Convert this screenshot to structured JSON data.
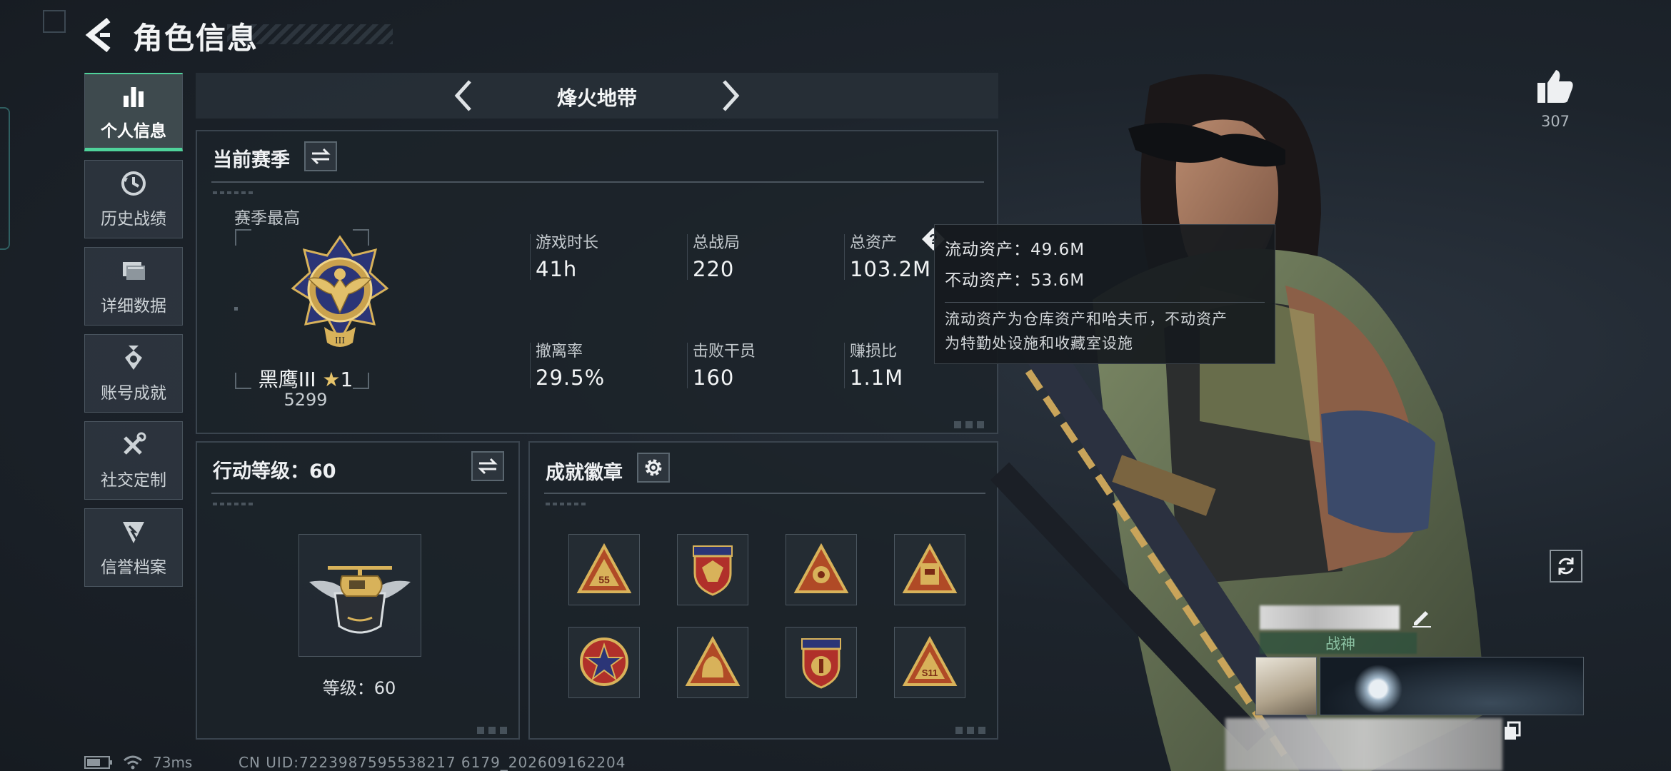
{
  "header": {
    "title": "角色信息"
  },
  "sidebar": {
    "items": [
      {
        "label": "个人信息",
        "icon": "bar-chart-icon",
        "active": true
      },
      {
        "label": "历史战绩",
        "icon": "history-clock-icon"
      },
      {
        "label": "详细数据",
        "icon": "folder-icon"
      },
      {
        "label": "账号成就",
        "icon": "achievement-medal-icon"
      },
      {
        "label": "社交定制",
        "icon": "tools-icon"
      },
      {
        "label": "信誉档案",
        "icon": "reputation-icon"
      }
    ]
  },
  "mode_selector": {
    "label": "烽火地带"
  },
  "season": {
    "title": "当前赛季",
    "best_label": "赛季最高",
    "rank_name": "黑鹰III",
    "rank_stars": "1",
    "rank_points": "5299",
    "stats": [
      {
        "label": "游戏时长",
        "value": "41h"
      },
      {
        "label": "总战局",
        "value": "220"
      },
      {
        "label": "总资产",
        "value": "103.2M"
      },
      {
        "label": "撤离率",
        "value": "29.5%"
      },
      {
        "label": "击败干员",
        "value": "160"
      },
      {
        "label": "赚损比",
        "value": "1.1M"
      }
    ]
  },
  "tooltip": {
    "liquid": "流动资产：49.6M",
    "fixed": "不动资产：53.6M",
    "desc_line1": "流动资产为仓库资产和哈夫币，不动资产",
    "desc_line2": "为特勤处设施和收藏室设施"
  },
  "action_level": {
    "title": "行动等级：60",
    "level_text": "等级：60"
  },
  "badges": {
    "title": "成就徽章",
    "items": [
      "badge-triangle-55",
      "badge-eagle-shield",
      "badge-triangle-target",
      "badge-triangle-tower",
      "badge-round-star",
      "badge-triangle-helmet",
      "badge-shield-gold",
      "badge-triangle-s11"
    ]
  },
  "likes": {
    "count": "307"
  },
  "profile_card": {
    "title_tag": "战神"
  },
  "status": {
    "ping": "73ms",
    "uid": "CN UID:7223987595538217 6179_202609162204"
  },
  "colors": {
    "accent": "#4fd29a",
    "panel": "#1c232a",
    "gold": "#d8b25a"
  }
}
